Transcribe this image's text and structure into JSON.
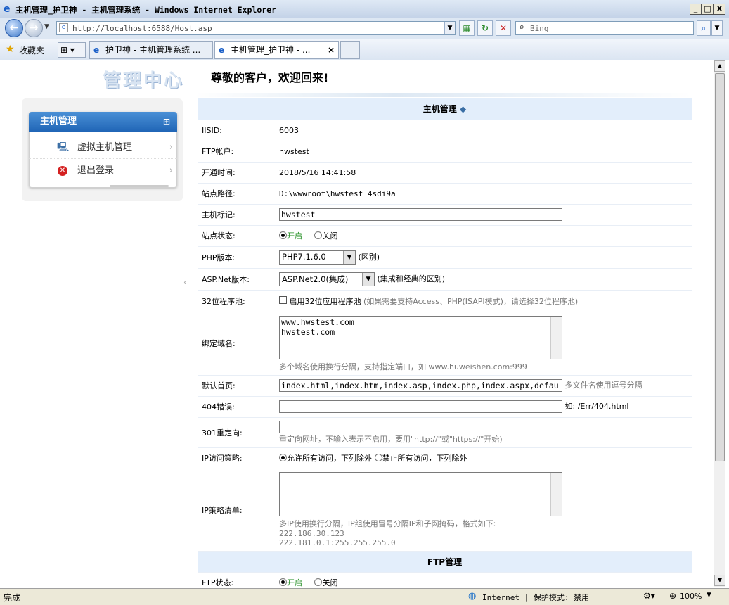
{
  "window": {
    "title": "主机管理_护卫神 - 主机管理系统 - Windows Internet Explorer",
    "min": "_",
    "max": "□",
    "close": "X"
  },
  "browser": {
    "address": "http://localhost:6588/Host.asp",
    "search_placeholder": "Bing",
    "favorites": "收藏夹",
    "tabs": [
      "护卫神 - 主机管理系统 ...",
      "主机管理_护卫神 - ..."
    ],
    "tab_close": "×"
  },
  "status": {
    "left": "完成",
    "zone": "Internet | 保护模式: 禁用",
    "zoom": "100%"
  },
  "page": {
    "logo": "管理中心",
    "welcome": "尊敬的客户，欢迎回来!",
    "sidebar": {
      "title": "主机管理",
      "expand": "⊞",
      "items": [
        {
          "label": "虚拟主机管理",
          "icon": "host-icon"
        },
        {
          "label": "退出登录",
          "icon": "logout-icon"
        }
      ]
    },
    "section1": "主机管理",
    "rows": {
      "iisid": {
        "label": "IISID:",
        "value": "6003"
      },
      "ftp": {
        "label": "FTP帐户:",
        "value": "hwstest"
      },
      "open_time": {
        "label": "开通时间:",
        "value": "2018/5/16 14:41:58"
      },
      "site_path": {
        "label": "站点路径:",
        "value": "D:\\wwwroot\\hwstest_4sdi9a"
      },
      "host_note": {
        "label": "主机标记:",
        "value": "hwstest"
      },
      "site_status": {
        "label": "站点状态:",
        "on": "开启",
        "off": "关闭"
      },
      "php": {
        "label": "PHP版本:",
        "value": "PHP7.1.6.0",
        "hint": "(区别)"
      },
      "aspnet": {
        "label": "ASP.Net版本:",
        "value": "ASP.Net2.0(集成)",
        "hint": "(集成和经典的区别)"
      },
      "pool32": {
        "label": "32位程序池:",
        "check": "启用32位应用程序池",
        "hint": "(如果需要支持Access、PHP(ISAPI模式)，请选择32位程序池)"
      },
      "domains": {
        "label": "绑定域名:",
        "value": "www.hwstest.com\nhwstest.com",
        "hint": "多个域名使用换行分隔，支持指定端口，如 www.huweishen.com:999"
      },
      "default_page": {
        "label": "默认首页:",
        "value": "index.html,index.htm,index.asp,index.php,index.aspx,defau",
        "hint": "多文件名使用逗号分隔"
      },
      "err404": {
        "label": "404错误:",
        "value": "",
        "hint": "如: /Err/404.html"
      },
      "redirect301": {
        "label": "301重定向:",
        "value": "",
        "hint": "重定向网址，不输入表示不启用，要用\"http://\"或\"https://\"开始)"
      },
      "ip_policy": {
        "label": "IP访问策略:",
        "allow": "允许所有访问，下列除外",
        "deny": "禁止所有访问，下列除外"
      },
      "ip_list": {
        "label": "IP策略清单:",
        "value": "",
        "hint": "多IP使用换行分隔，IP组使用冒号分隔IP和子网掩码，格式如下:",
        "ex1": "222.186.30.123",
        "ex2": "222.181.0.1:255.255.255.0"
      }
    },
    "section2": "FTP管理",
    "ftp_status": {
      "label": "FTP状态:",
      "on": "开启",
      "off": "关闭"
    }
  }
}
